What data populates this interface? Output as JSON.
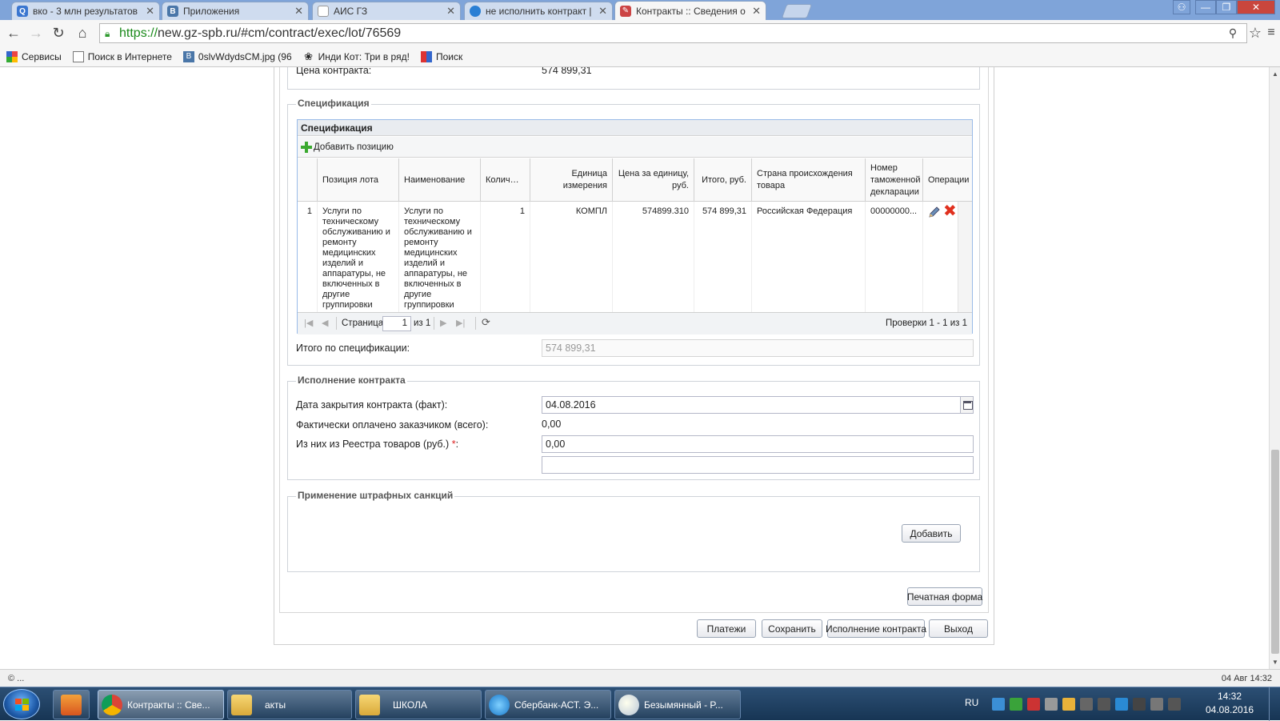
{
  "browser": {
    "tabs": [
      {
        "title": "вко - 3 млн результатов",
        "icon": "search-icon"
      },
      {
        "title": "Приложения",
        "icon": "vk-icon"
      },
      {
        "title": "АИС ГЗ",
        "icon": "page-icon"
      },
      {
        "title": "не исполнить контракт |",
        "icon": "globe-icon"
      },
      {
        "title": "Контракты :: Сведения о",
        "icon": "hammer-icon"
      }
    ],
    "close_glyph": "✕",
    "url_scheme": "https://",
    "url_rest": "new.gz-spb.ru/#cm/contract/exec/lot/76569",
    "bookmarks": [
      {
        "label": "Сервисы",
        "icon": "apps-grid-icon"
      },
      {
        "label": "Поиск в Интернете",
        "icon": "page-icon"
      },
      {
        "label": "0slvWdydsCM.jpg (96",
        "icon": "vk-icon"
      },
      {
        "label": "Инди Кот: Три в ряд!",
        "icon": "paw-icon"
      },
      {
        "label": "Поиск",
        "icon": "mosaic-icon"
      }
    ]
  },
  "contract": {
    "price_label": "Цена контракта:",
    "price_value": "574 899,31"
  },
  "spec": {
    "legend": "Спецификация",
    "grid_title": "Спецификация",
    "add_label": "Добавить позицию",
    "columns": {
      "position": "Позиция лота",
      "name": "Наименование",
      "qty": "Колич…",
      "unit": "Единица измерения",
      "unit_price": "Цена за единицу, руб.",
      "total": "Итого, руб.",
      "country": "Страна происхождения товара",
      "customs": "Номер таможенной декларации",
      "ops": "Операции"
    },
    "row": {
      "num": "1",
      "position": "Услуги по техническому обслуживанию и ремонту медицинских изделий и аппаратуры, не включенных в другие группировки",
      "name": "Услуги по техническому обслуживанию и ремонту медицинских изделий и аппаратуры, не включенных в другие группировки",
      "qty": "1",
      "unit": "КОМПЛ",
      "unit_price": "574899.310",
      "total": "574 899,31",
      "country": "Российская Федерация",
      "customs": "00000000..."
    },
    "paging": {
      "page_label": "Страница",
      "page_value": "1",
      "of_label": "из 1",
      "summary": "Проверки 1 - 1 из 1"
    },
    "total_label": "Итого по спецификации:",
    "total_value": "574 899,31"
  },
  "execution": {
    "legend": "Исполнение контракта",
    "close_date_label": "Дата закрытия контракта (факт):",
    "close_date_value": "04.08.2016",
    "paid_label": "Фактически оплачено заказчиком (всего):",
    "paid_value": "0,00",
    "registry_label": "Из них из Реестра товаров (руб.)",
    "required_mark": "*",
    "colon": ":",
    "registry_value": "0,00",
    "extra_value": ""
  },
  "penalties": {
    "legend": "Применение штрафных санкций",
    "add_button": "Добавить"
  },
  "buttons": {
    "print": "Печатная форма",
    "payments": "Платежи",
    "save": "Сохранить",
    "exec": "Исполнение контракта",
    "exit": "Выход"
  },
  "status": {
    "left": "© ...",
    "right": "04 Авг 14:32"
  },
  "taskbar": {
    "tasks": [
      {
        "label": "Контракты :: Све...",
        "icon": "chrome-icon"
      },
      {
        "label": "акты",
        "icon": "folder-icon"
      },
      {
        "label": "ШКОЛА",
        "icon": "folder-icon"
      },
      {
        "label": "Сбербанк-АСТ. Э...",
        "icon": "ie-icon"
      },
      {
        "label": "Безымянный - P...",
        "icon": "paint-icon"
      }
    ],
    "lang": "RU",
    "time": "14:32",
    "date": "04.08.2016"
  }
}
